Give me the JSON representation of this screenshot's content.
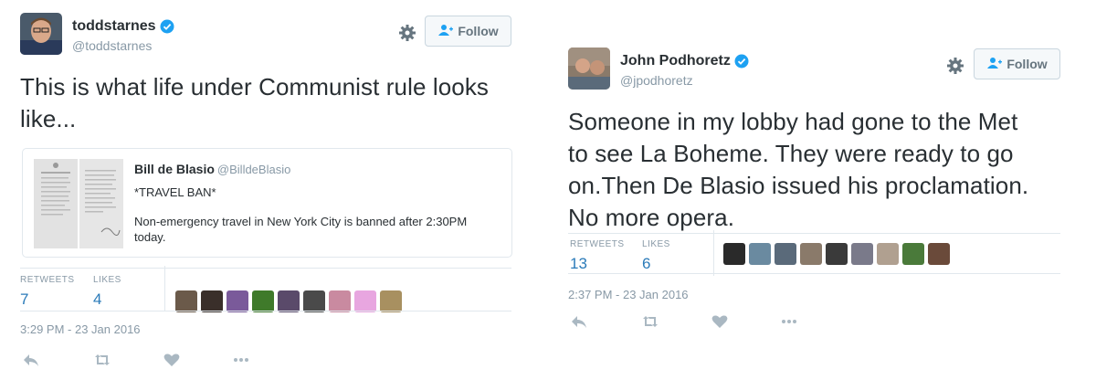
{
  "tweet1": {
    "display_name": "toddstarnes",
    "handle": "@toddstarnes",
    "follow_label": "Follow",
    "text": "This is what life under Communist rule looks like...",
    "quote": {
      "name": "Bill de Blasio",
      "handle": "@BilldeBlasio",
      "text1": "*TRAVEL BAN*",
      "text2": "Non-emergency travel in New York City is banned after 2:30PM today."
    },
    "retweets_label": "RETWEETS",
    "retweets": "7",
    "likes_label": "LIKES",
    "likes": "4",
    "likers": [
      "#6b5a4a",
      "#3a2f2a",
      "#7a5a9a",
      "#3f7a2a",
      "#5a4a6a",
      "#4a4a4a",
      "#c98aa0",
      "#e8a6e0",
      "#a89060"
    ],
    "timestamp": "3:29 PM - 23 Jan 2016"
  },
  "tweet2": {
    "display_name": "John Podhoretz",
    "handle": "@jpodhoretz",
    "follow_label": "Follow",
    "text_lines": [
      "Someone in my lobby had gone to the Met",
      "to see La Boheme. They were ready to go",
      "on.Then De Blasio issued his proclamation.",
      "No more opera."
    ],
    "retweets_label": "RETWEETS",
    "retweets": "13",
    "likes_label": "LIKES",
    "likes": "6",
    "likers": [
      "#2a2a2a",
      "#6a8aa0",
      "#5a6a7a",
      "#8a7a6a",
      "#3a3a3a",
      "#7a7a8a",
      "#b0a090",
      "#4a7a3a",
      "#6a4a3a"
    ],
    "timestamp": "2:37 PM - 23 Jan 2016"
  },
  "colors": {
    "link": "#2b7bb9",
    "muted": "#8899a6",
    "verified": "#1da1f2",
    "border": "#e1e8ed"
  },
  "icons": [
    "verified-badge-icon",
    "gear-icon",
    "follow-person-plus-icon",
    "reply-icon",
    "retweet-icon",
    "like-heart-icon",
    "more-dots-icon"
  ]
}
